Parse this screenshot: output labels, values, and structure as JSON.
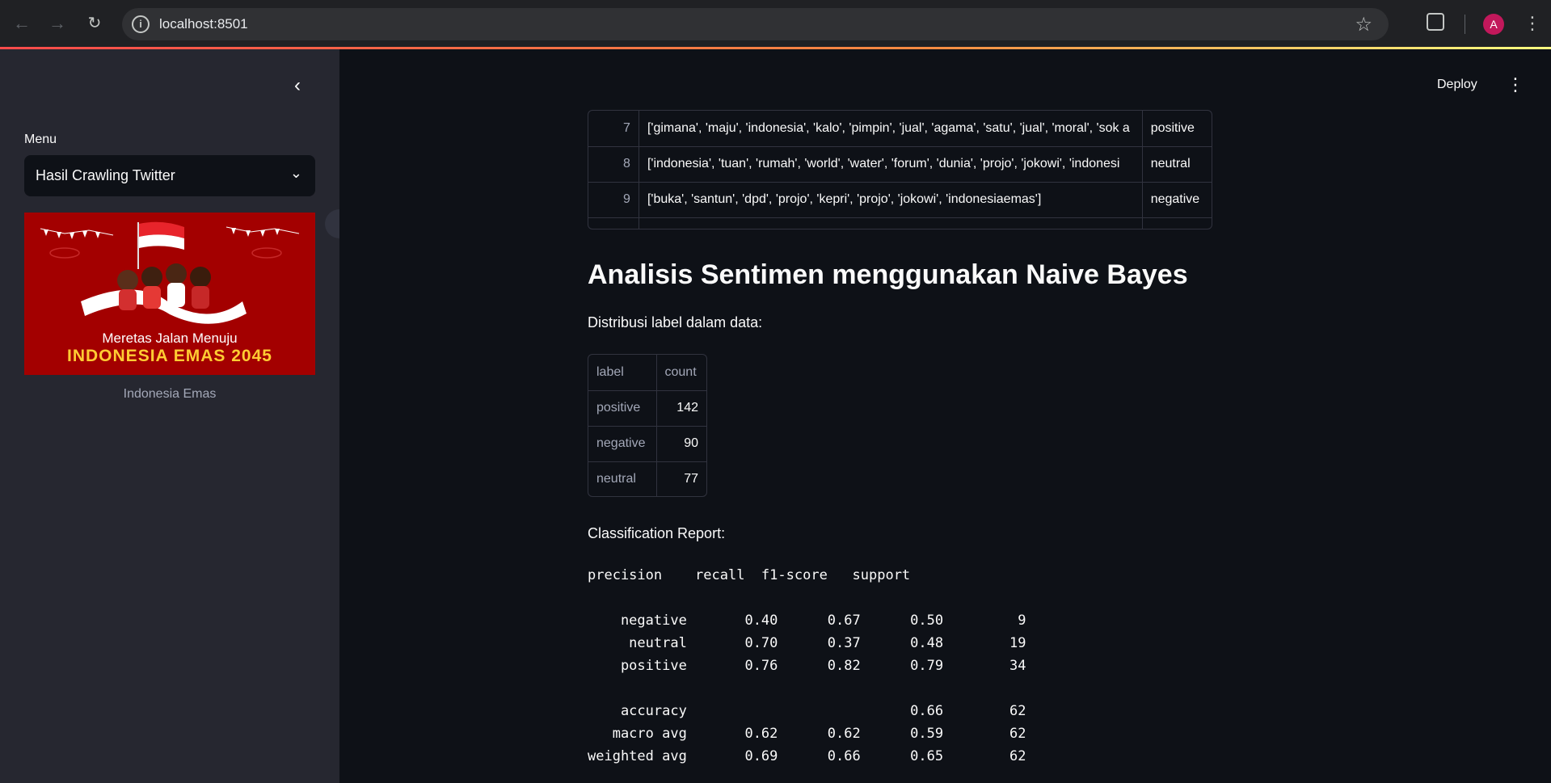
{
  "browser": {
    "url": "localhost:8501",
    "avatar_letter": "A",
    "icons": [
      "back-arrow-icon",
      "forward-arrow-icon",
      "reload-icon",
      "site-info-icon",
      "star-icon",
      "extensions-icon",
      "menu-dots-icon"
    ]
  },
  "sidebar": {
    "menu_label": "Menu",
    "select_value": "Hasil Crawling Twitter",
    "banner_subtitle": "Meretas Jalan Menuju",
    "banner_title": "INDONESIA EMAS 2045",
    "banner_caption": "Indonesia Emas"
  },
  "header": {
    "deploy_label": "Deploy"
  },
  "data_table": {
    "rows": [
      {
        "index": "7",
        "tokens": "['gimana', 'maju', 'indonesia', 'kalo', 'pimpin', 'jual', 'agama', 'satu', 'jual', 'moral', 'sok a",
        "label": "positive"
      },
      {
        "index": "8",
        "tokens": "['indonesia', 'tuan', 'rumah', 'world', 'water', 'forum', 'dunia', 'projo', 'jokowi', 'indonesi",
        "label": "neutral"
      },
      {
        "index": "9",
        "tokens": "['buka', 'santun', 'dpd', 'projo', 'kepri', 'projo', 'jokowi', 'indonesiaemas']",
        "label": "negative"
      }
    ]
  },
  "analysis": {
    "title": "Analisis Sentimen menggunakan Naive Bayes",
    "distribution_label": "Distribusi label dalam data:",
    "distribution": {
      "headers": [
        "label",
        "count"
      ],
      "rows": [
        {
          "label": "positive",
          "count": "142"
        },
        {
          "label": "negative",
          "count": "90"
        },
        {
          "label": "neutral",
          "count": "77"
        }
      ]
    },
    "report_label": "Classification Report:",
    "report_text": "precision    recall  f1-score   support\n\n    negative       0.40      0.67      0.50         9\n     neutral       0.70      0.37      0.48        19\n    positive       0.76      0.82      0.79        34\n\n    accuracy                           0.66        62\n   macro avg       0.62      0.62      0.59        62\nweighted avg       0.69      0.66      0.65        62"
  },
  "colors": {
    "app_background": "#0e1117",
    "sidebar_background": "#262730",
    "banner_red": "#a30000",
    "banner_gold": "#ffcc33"
  }
}
